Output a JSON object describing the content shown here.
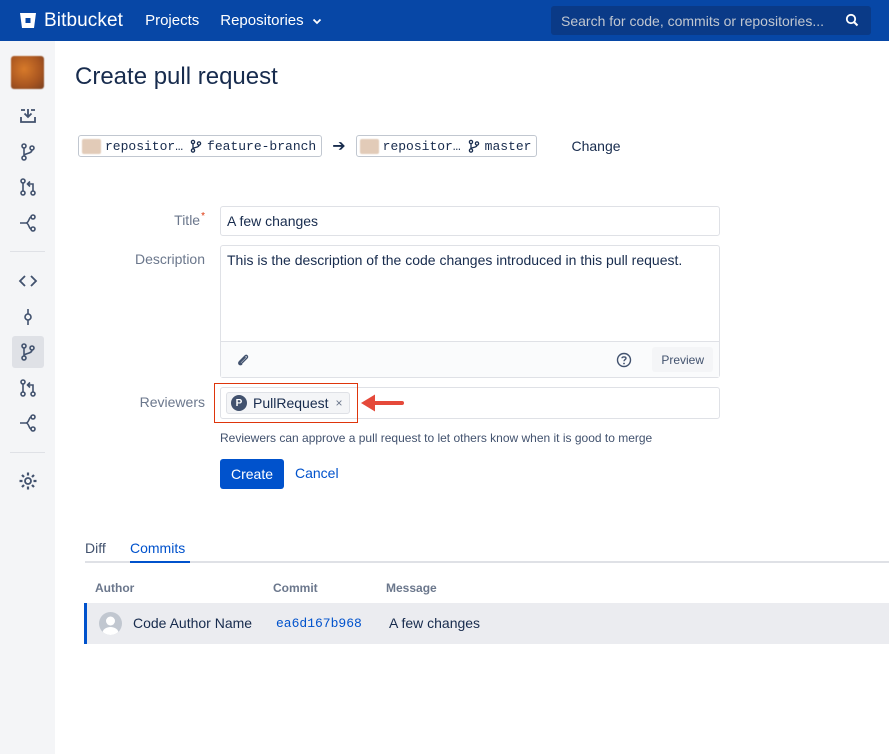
{
  "header": {
    "brand": "Bitbucket",
    "nav": [
      "Projects",
      "Repositories"
    ],
    "search_placeholder": "Search for code, commits or repositories..."
  },
  "page": {
    "title": "Create pull request"
  },
  "branches": {
    "source_repo": "repositor…",
    "source_branch": "feature-branch",
    "target_repo": "repositor…",
    "target_branch": "master",
    "change_label": "Change"
  },
  "form": {
    "title_label": "Title",
    "title_value": "A few changes",
    "description_label": "Description",
    "description_value": "This is the description of the code changes introduced in this pull request.",
    "preview_label": "Preview",
    "reviewers_label": "Reviewers",
    "reviewer_name": "PullRequest",
    "reviewer_remove": "×",
    "reviewers_help": "Reviewers can approve a pull request to let others know when it is good to merge",
    "create_label": "Create",
    "cancel_label": "Cancel"
  },
  "tabs": [
    "Diff",
    "Commits"
  ],
  "active_tab": "Commits",
  "commits": {
    "columns": [
      "Author",
      "Commit",
      "Message"
    ],
    "rows": [
      {
        "author": "Code Author Name",
        "commit": "ea6d167b968",
        "message": "A few changes"
      }
    ]
  },
  "colors": {
    "header_bg": "#0747a6",
    "primary": "#0052cc",
    "highlight": "#de350b"
  }
}
